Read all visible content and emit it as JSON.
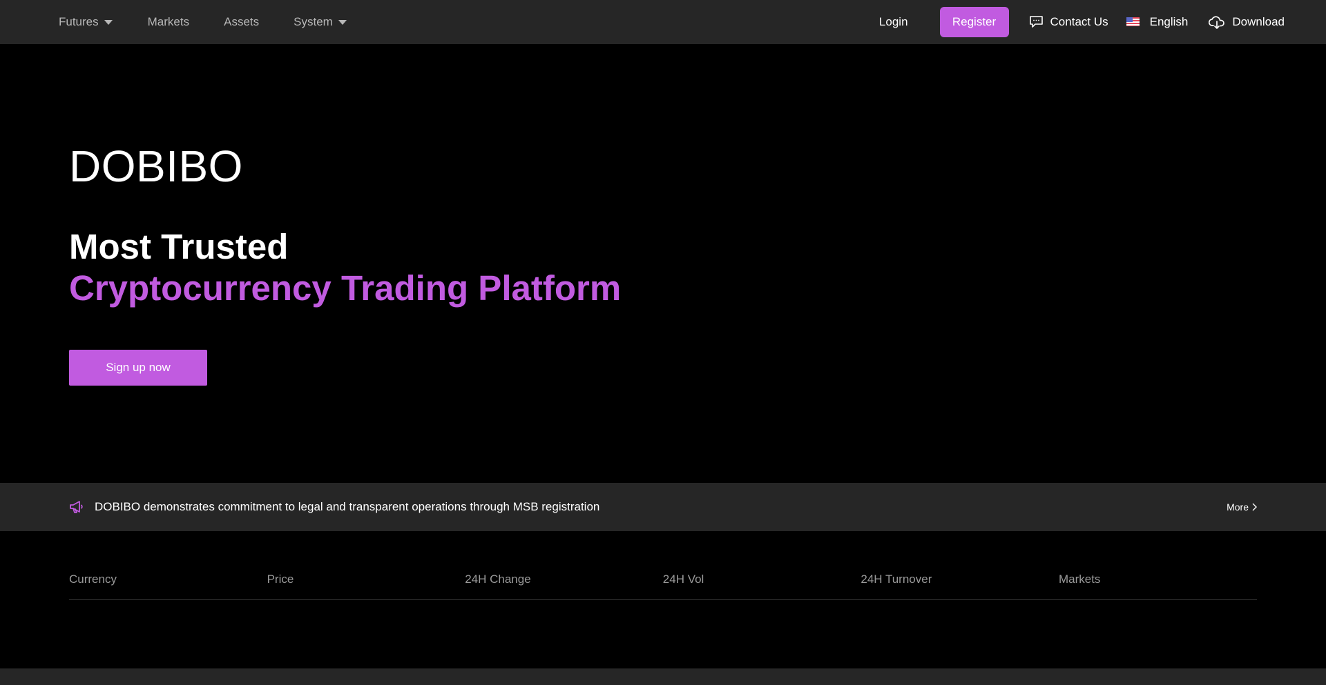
{
  "nav": {
    "left": [
      {
        "label": "Futures",
        "has_dropdown": true
      },
      {
        "label": "Markets",
        "has_dropdown": false
      },
      {
        "label": "Assets",
        "has_dropdown": false
      },
      {
        "label": "System",
        "has_dropdown": true
      }
    ],
    "login": "Login",
    "register": "Register",
    "contact": "Contact Us",
    "language": "English",
    "download": "Download"
  },
  "hero": {
    "brand": "DOBIBO",
    "headline_line1": "Most Trusted",
    "headline_line2": "Cryptocurrency Trading Platform",
    "cta": "Sign up now"
  },
  "notice": {
    "text": "DOBIBO demonstrates commitment to legal and transparent operations through MSB registration",
    "more": "More"
  },
  "market_table": {
    "columns": [
      "Currency",
      "Price",
      "24H Change",
      "24H Vol",
      "24H Turnover",
      "Markets"
    ]
  },
  "colors": {
    "accent": "#c15be0",
    "topbar_bg": "#262626",
    "page_bg": "#000000"
  }
}
